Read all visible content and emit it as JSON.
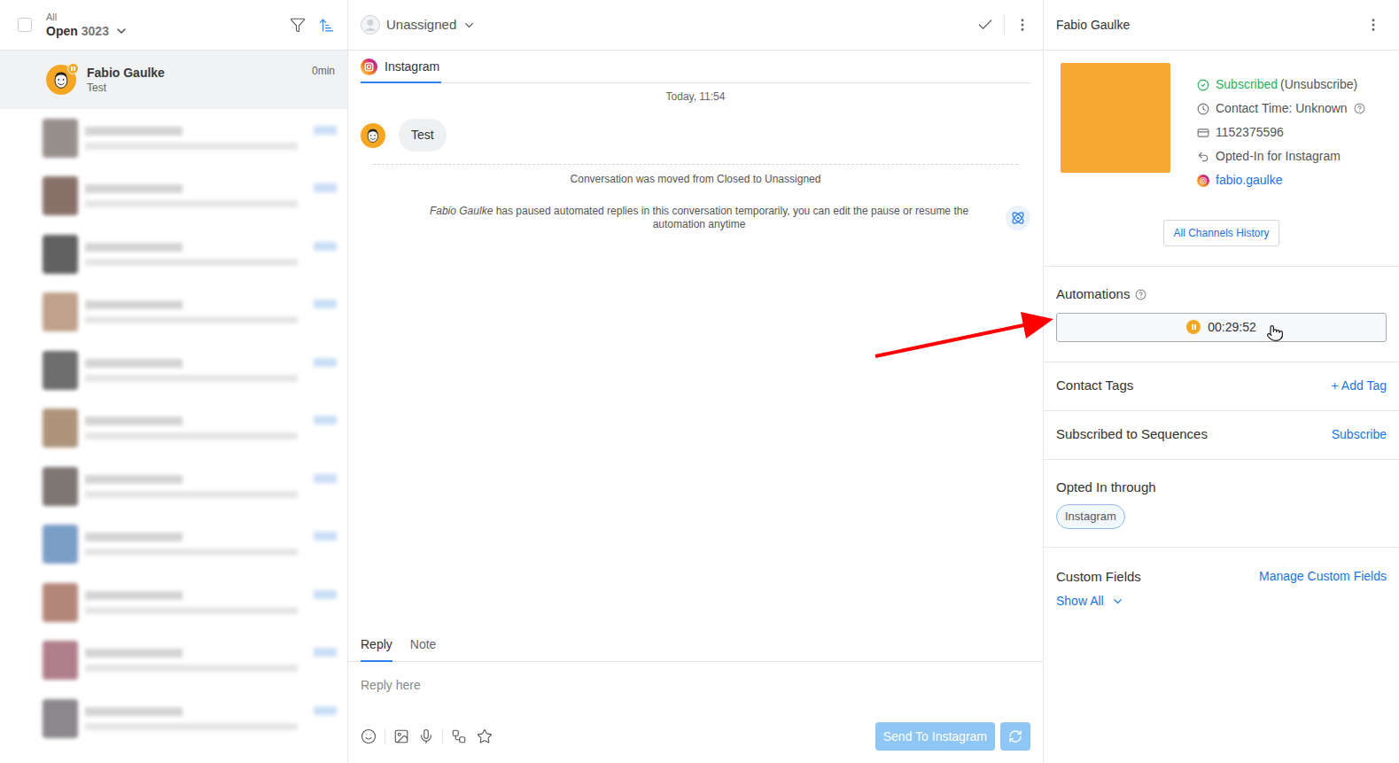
{
  "list_header": {
    "scope": "All",
    "filter": "Open",
    "count": "3023"
  },
  "contacts": [
    {
      "kind": "contact",
      "name": "Fabio Gaulke",
      "preview": "Test",
      "time": "0min",
      "selected": true,
      "paused": true,
      "color": "#f5a623"
    },
    {
      "kind": "redacted",
      "selected": false,
      "color": "#7d746f"
    },
    {
      "kind": "redacted",
      "selected": false,
      "color": "#6b4e44"
    },
    {
      "kind": "redacted",
      "selected": false,
      "color": "#3c3a3a"
    },
    {
      "kind": "redacted",
      "selected": false,
      "color": "#b08a70"
    },
    {
      "kind": "redacted",
      "selected": false,
      "color": "#4a4a4a"
    },
    {
      "kind": "redacted",
      "selected": false,
      "color": "#9a7a5a"
    },
    {
      "kind": "redacted",
      "selected": false,
      "color": "#5e5450"
    },
    {
      "kind": "redacted",
      "selected": false,
      "color": "#5b86b8"
    },
    {
      "kind": "redacted",
      "selected": false,
      "color": "#a06a58"
    },
    {
      "kind": "redacted",
      "selected": false,
      "color": "#9c5f70"
    },
    {
      "kind": "redacted",
      "selected": false,
      "color": "#6f6a70"
    }
  ],
  "conversation": {
    "assignee": "Unassigned",
    "channel": "Instagram",
    "date": "Today, 11:54",
    "messages": [
      {
        "text": "Test"
      }
    ],
    "status_event": "Conversation was moved from Closed to Unassigned",
    "pause_event": {
      "actor": "Fabio Gaulke",
      "text": " has paused automated replies in this conversation temporarily, you can edit the pause or resume the automation anytime"
    }
  },
  "composer": {
    "tabs": [
      {
        "label": "Reply",
        "selected": true
      },
      {
        "label": "Note",
        "selected": false
      }
    ],
    "placeholder": "Reply here",
    "send": "Send To Instagram",
    "send_disabled": true
  },
  "profile": {
    "name": "Fabio Gaulke",
    "subscribed": {
      "label": "Subscribed",
      "action": "(Unsubscribe)",
      "on": true
    },
    "contact_time": "Contact Time: Unknown",
    "id": "1152375596",
    "opt_in": "Opted-In for Instagram",
    "handle": "fabio.gaulke",
    "history_button": "All Channels History"
  },
  "automations": {
    "title": "Automations",
    "timer": "00:29:52",
    "paused": true
  },
  "tags": {
    "title": "Contact Tags",
    "action": "+ Add Tag"
  },
  "sequences": {
    "title": "Subscribed to Sequences",
    "action": "Subscribe"
  },
  "opted_in": {
    "title": "Opted In through",
    "chips": [
      "Instagram"
    ]
  },
  "custom_fields": {
    "title": "Custom Fields",
    "action": "Manage Custom Fields",
    "toggle": "Show All",
    "expanded": false
  }
}
